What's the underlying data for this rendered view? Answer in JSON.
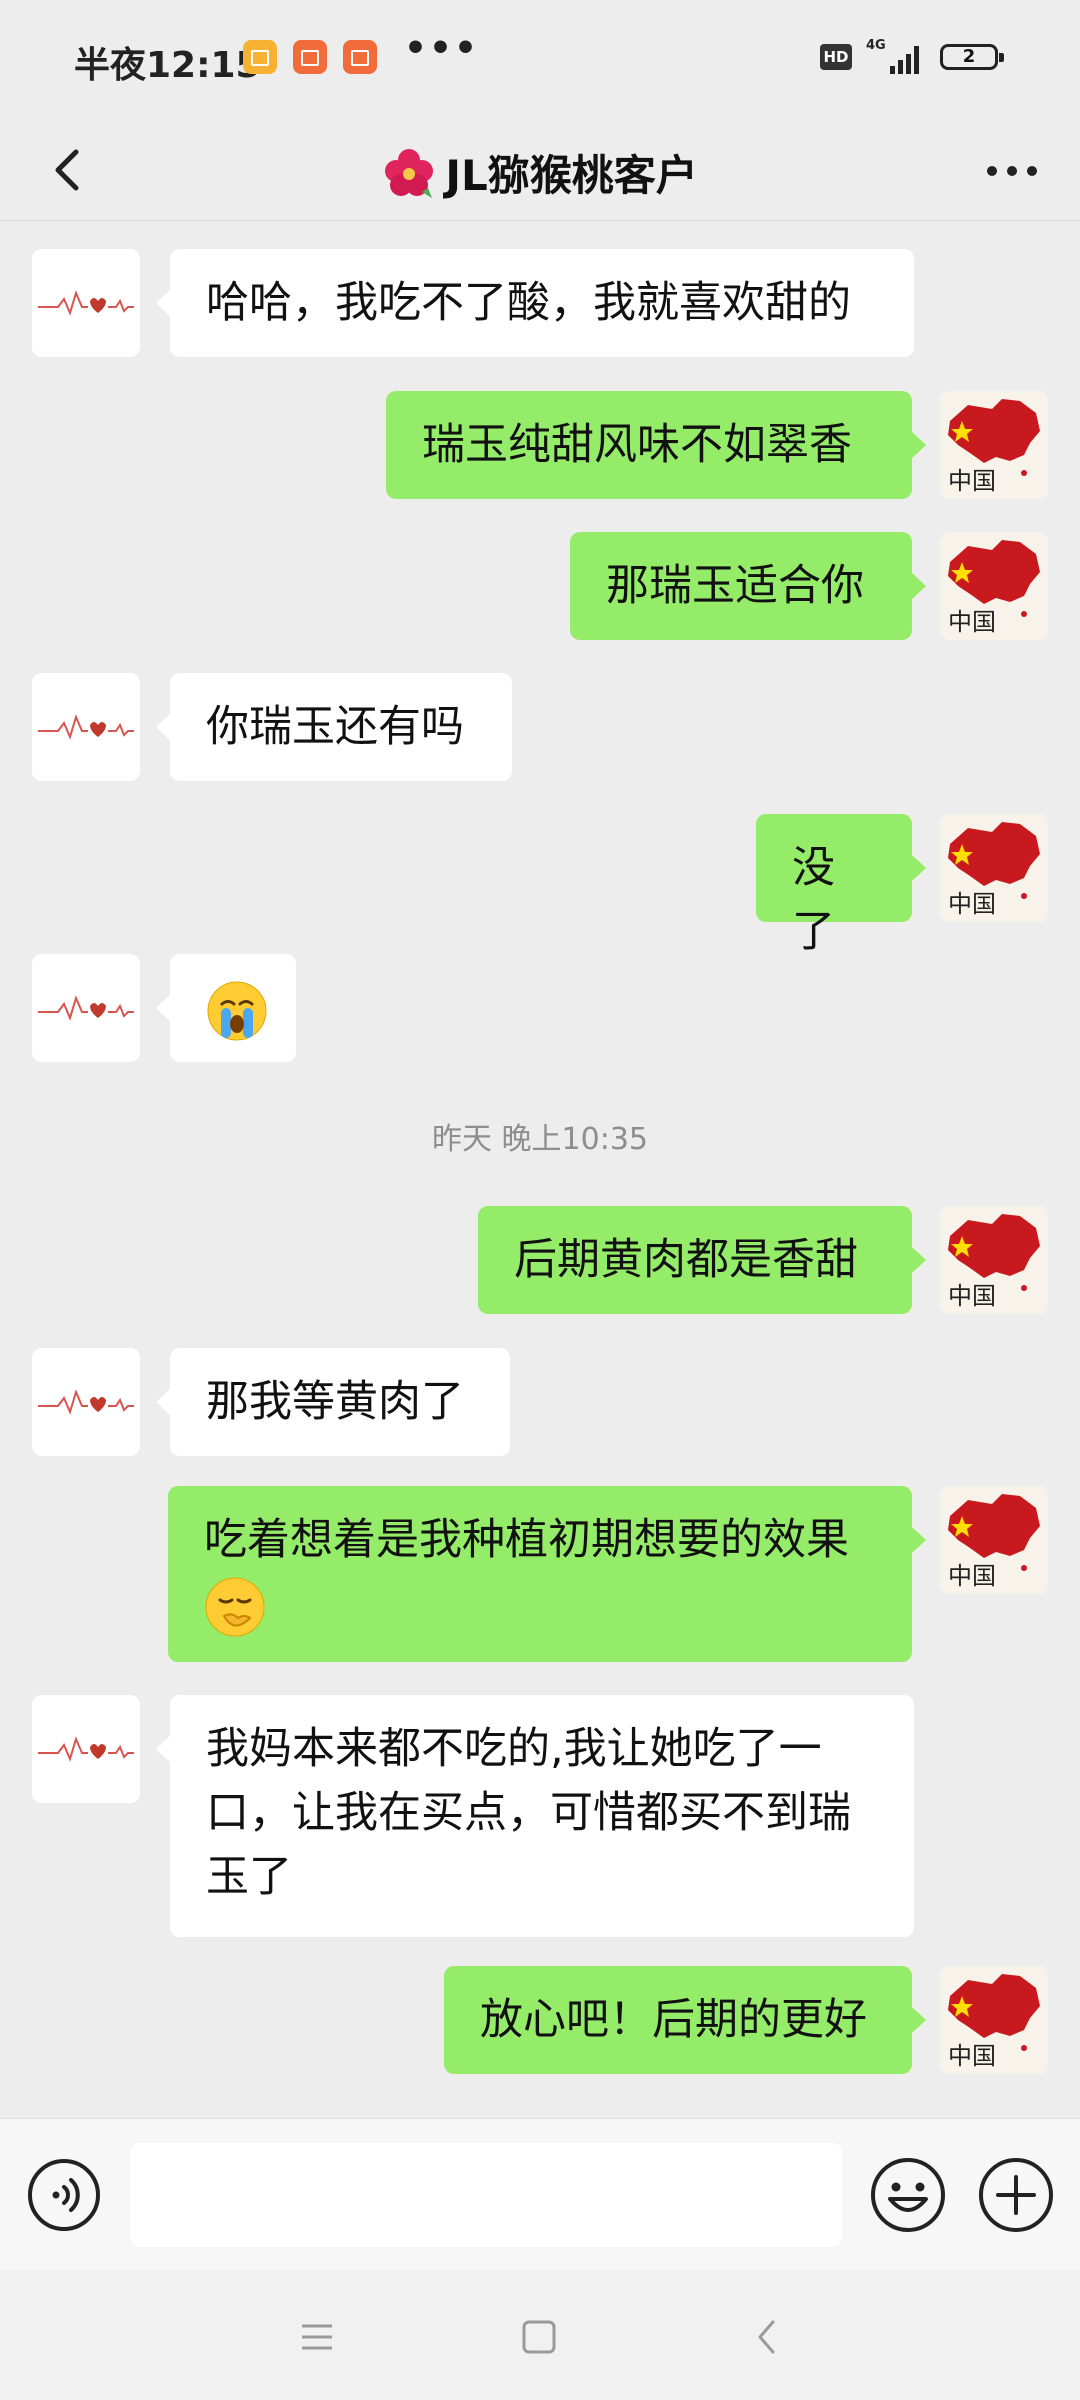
{
  "status_bar": {
    "time": "半夜12:15",
    "more": "•••",
    "hd_badge": "HD",
    "network": "4G",
    "battery": "2"
  },
  "header": {
    "title": "JL猕猴桃客户",
    "title_icon": "hibiscus-flower-icon",
    "back_icon": "chevron-left-icon",
    "more_icon": "more-dots-icon"
  },
  "messages": [
    {
      "side": "left",
      "text": "哈哈，我吃不了酸，我就喜欢甜的"
    },
    {
      "side": "right",
      "text": "瑞玉纯甜风味不如翠香"
    },
    {
      "side": "right",
      "text": "那瑞玉适合你"
    },
    {
      "side": "left",
      "text": "你瑞玉还有吗"
    },
    {
      "side": "right",
      "text": "没了"
    },
    {
      "side": "left",
      "text": "",
      "emoji": "crying-face-icon"
    },
    {
      "side": "right",
      "text": "后期黄肉都是香甜"
    },
    {
      "side": "left",
      "text": "那我等黄肉了"
    },
    {
      "side": "right",
      "text": "吃着想着是我种植初期想要的效果",
      "emoji": "thinking-hand-over-mouth-icon"
    },
    {
      "side": "left",
      "text": "我妈本来都不吃的,我让她吃了一口，让我在买点，可惜都买不到瑞玉了"
    },
    {
      "side": "right",
      "text": "放心吧！后期的更好"
    }
  ],
  "timestamp": "昨天 晚上10:35",
  "avatars": {
    "contact": "heartbeat-line-avatar",
    "me": "china-map-avatar",
    "me_caption": "中国"
  },
  "input_bar": {
    "message_value": "",
    "voice_icon": "voice-icon",
    "emoji_icon": "smiley-icon",
    "plus_icon": "plus-circle-icon"
  },
  "nav_bar": {
    "menu_icon": "menu-icon",
    "home_icon": "home-square-icon",
    "back_icon": "nav-back-icon"
  },
  "colors": {
    "background": "#ededed",
    "outgoing_bubble": "#95ec69",
    "incoming_bubble": "#ffffff",
    "timestamp_text": "#8e8e8e"
  }
}
